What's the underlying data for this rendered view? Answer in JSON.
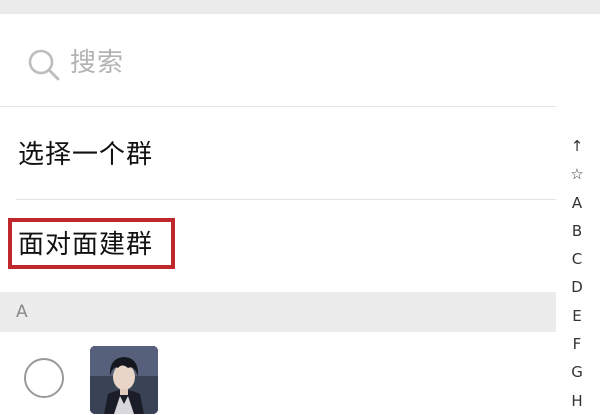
{
  "search": {
    "placeholder": "搜索"
  },
  "menu": {
    "select_group": "选择一个群",
    "face_to_face": "面对面建群"
  },
  "section": {
    "letter": "A"
  },
  "index_bar": [
    "↑",
    "☆",
    "A",
    "B",
    "C",
    "D",
    "E",
    "F",
    "G",
    "H"
  ],
  "colors": {
    "highlight_border": "#c0272d",
    "section_background": "#ececec",
    "placeholder_text": "#b3b3b3"
  }
}
